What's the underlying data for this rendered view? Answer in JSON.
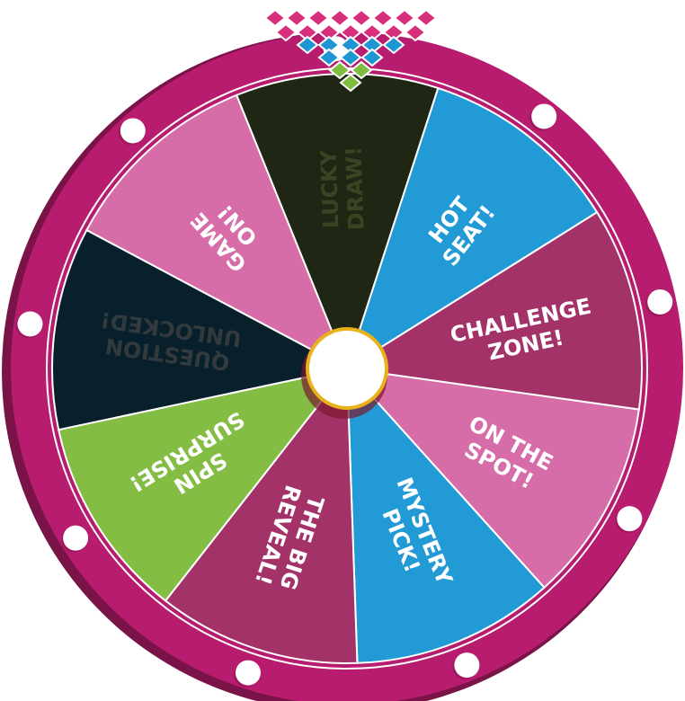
{
  "wheel": {
    "segments": [
      {
        "lines": [
          "LUCKY",
          "DRAW!"
        ],
        "color": "#1f2613",
        "text_color": "#3b4422"
      },
      {
        "lines": [
          "HOT",
          "SEAT!"
        ],
        "color": "#229ad6",
        "text_color": "#ffffff"
      },
      {
        "lines": [
          "CHALLENGE",
          "ZONE!"
        ],
        "color": "#a33269",
        "text_color": "#ffffff"
      },
      {
        "lines": [
          "ON THE",
          "SPOT!"
        ],
        "color": "#d66ca8",
        "text_color": "#ffffff"
      },
      {
        "lines": [
          "MYSTERY",
          "PICK!"
        ],
        "color": "#229ad6",
        "text_color": "#ffffff"
      },
      {
        "lines": [
          "THE BIG",
          "REVEAL!"
        ],
        "color": "#a33269",
        "text_color": "#ffffff"
      },
      {
        "lines": [
          "SPIN",
          "SURPRISE!"
        ],
        "color": "#84bd44",
        "text_color": "#ffffff"
      },
      {
        "lines": [
          "QUESTION",
          "UNLOCKED!"
        ],
        "color": "#07202c",
        "text_color": "#333a3e"
      },
      {
        "lines": [
          "GAME",
          "ON!"
        ],
        "color": "#d66ca8",
        "text_color": "#ffffff"
      }
    ],
    "rim_color": "#b81c6e",
    "rim_shadow_color": "#7a1348",
    "hub_color": "#ffffff",
    "hub_ring_color": "#e9b21a",
    "peg_color": "#ffffff",
    "peg_count": 9,
    "pointer_colors": [
      "#d9307e",
      "#1f96d4",
      "#7fbd3f"
    ]
  }
}
